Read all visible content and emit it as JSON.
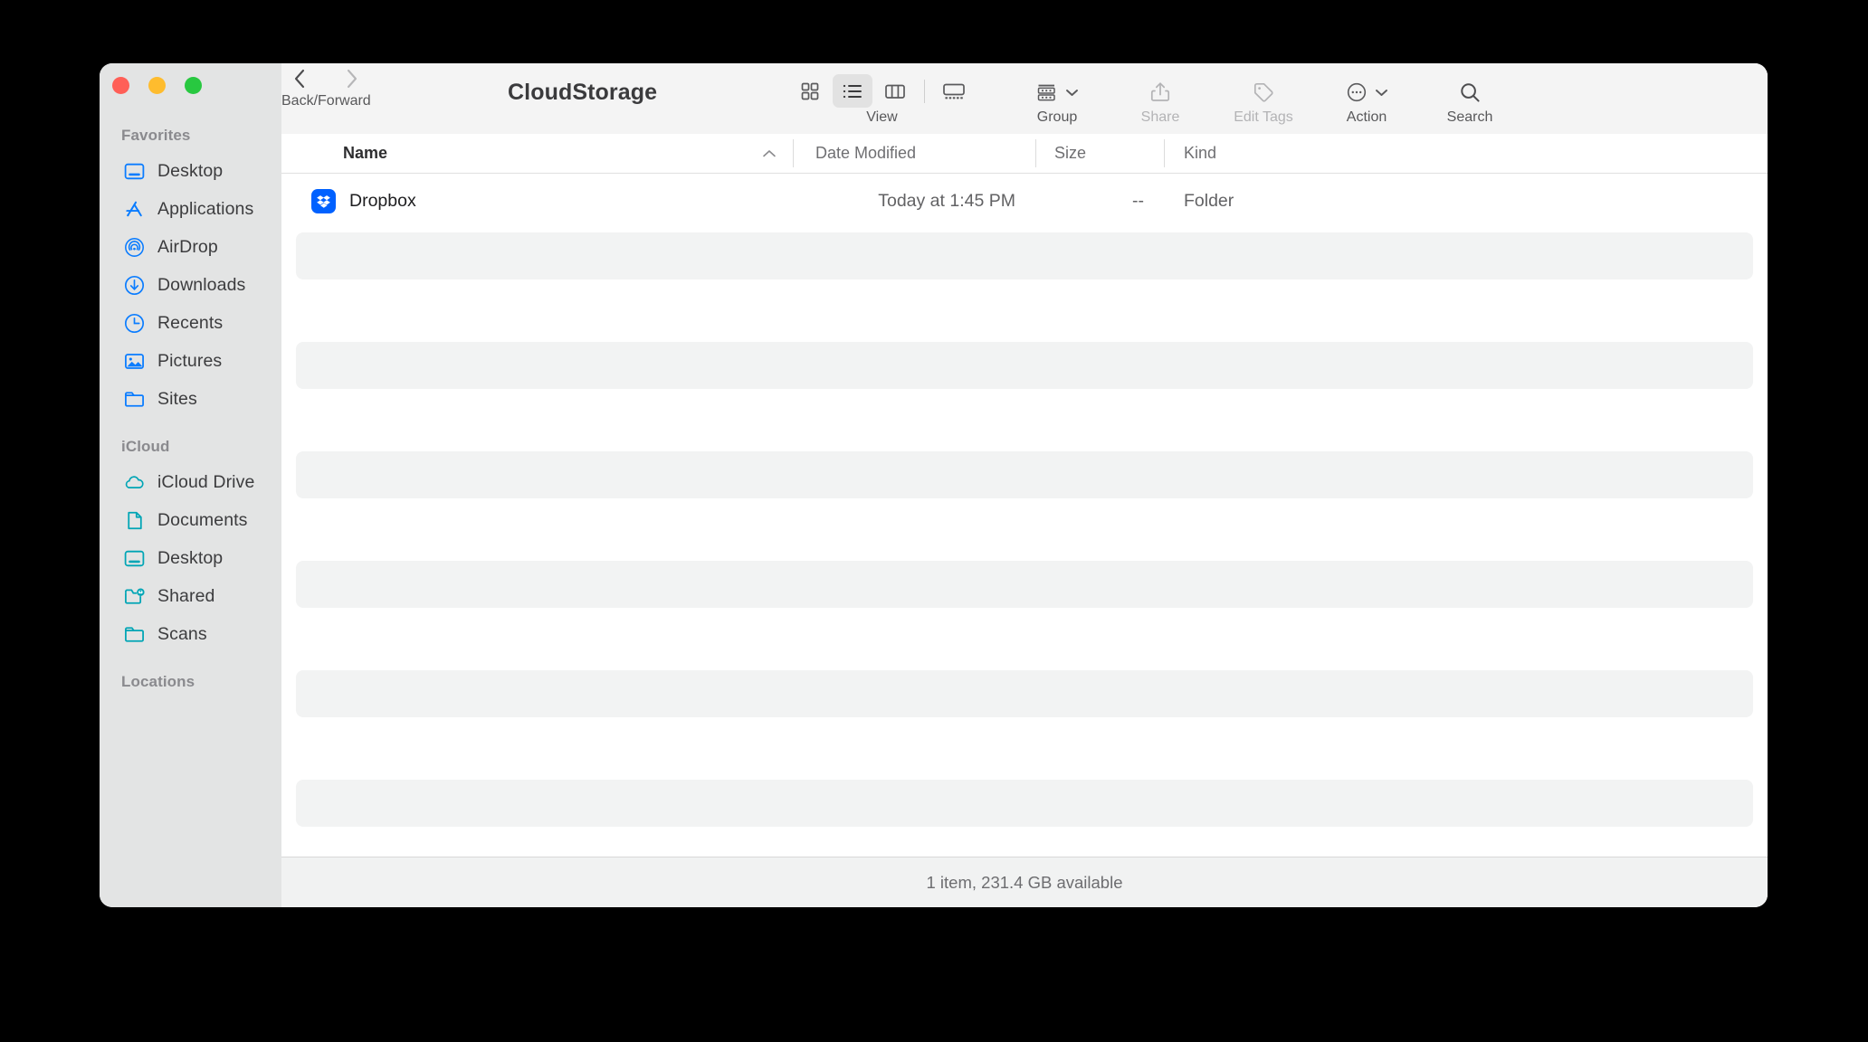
{
  "window": {
    "title": "CloudStorage",
    "traffic_lights": [
      {
        "name": "close",
        "color": "#ff5f57"
      },
      {
        "name": "minimize",
        "color": "#febc2e"
      },
      {
        "name": "zoom",
        "color": "#28c840"
      }
    ]
  },
  "toolbar": {
    "nav_caption": "Back/Forward",
    "view_caption": "View",
    "view_options": [
      {
        "id": "icon",
        "label": "Icon view",
        "active": false
      },
      {
        "id": "list",
        "label": "List view",
        "active": true
      },
      {
        "id": "column",
        "label": "Column view",
        "active": false
      },
      {
        "id": "gallery",
        "label": "Gallery view",
        "active": false
      }
    ],
    "actions": [
      {
        "id": "group",
        "label": "Group",
        "enabled": true,
        "chevron": true
      },
      {
        "id": "share",
        "label": "Share",
        "enabled": false,
        "chevron": false
      },
      {
        "id": "edit-tags",
        "label": "Edit Tags",
        "enabled": false,
        "chevron": false
      },
      {
        "id": "action",
        "label": "Action",
        "enabled": true,
        "chevron": true
      },
      {
        "id": "search",
        "label": "Search",
        "enabled": true,
        "chevron": false
      }
    ]
  },
  "sidebar": {
    "sections": [
      {
        "title": "Favorites",
        "items": [
          {
            "label": "Desktop",
            "icon": "desktop-icon",
            "color": "#0a7cff"
          },
          {
            "label": "Applications",
            "icon": "applications-icon",
            "color": "#0a7cff"
          },
          {
            "label": "AirDrop",
            "icon": "airdrop-icon",
            "color": "#0a7cff"
          },
          {
            "label": "Downloads",
            "icon": "downloads-icon",
            "color": "#0a7cff"
          },
          {
            "label": "Recents",
            "icon": "recents-clock-icon",
            "color": "#0a7cff"
          },
          {
            "label": "Pictures",
            "icon": "pictures-icon",
            "color": "#0a7cff"
          },
          {
            "label": "Sites",
            "icon": "folder-icon",
            "color": "#0a7cff"
          }
        ]
      },
      {
        "title": "iCloud",
        "items": [
          {
            "label": "iCloud Drive",
            "icon": "cloud-icon",
            "color": "#00a5b5"
          },
          {
            "label": "Documents",
            "icon": "document-icon",
            "color": "#00a5b5"
          },
          {
            "label": "Desktop",
            "icon": "desktop-icon",
            "color": "#00a5b5"
          },
          {
            "label": "Shared",
            "icon": "shared-folder-icon",
            "color": "#00a5b5"
          },
          {
            "label": "Scans",
            "icon": "folder-icon",
            "color": "#00a5b5"
          }
        ]
      },
      {
        "title": "Locations",
        "items": []
      }
    ]
  },
  "columns": {
    "name": "Name",
    "date_modified": "Date Modified",
    "size": "Size",
    "kind": "Kind",
    "sort_column": "Name",
    "sort_direction": "ascending"
  },
  "files": [
    {
      "name": "Dropbox",
      "icon": "dropbox-icon",
      "date_modified": "Today at 1:45 PM",
      "size": "--",
      "kind": "Folder"
    }
  ],
  "empty_row_count": 11,
  "status": {
    "text": "1 item, 231.4 GB available"
  }
}
